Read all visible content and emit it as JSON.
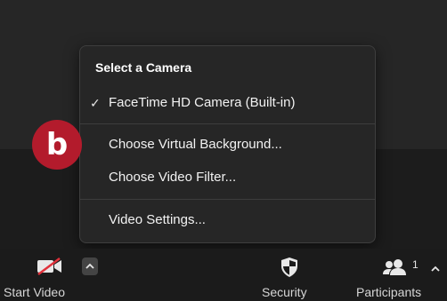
{
  "camera_menu": {
    "header": "Select a Camera",
    "selected_camera": "FaceTime HD Camera (Built-in)",
    "items": [
      "Choose Virtual Background...",
      "Choose Video Filter...",
      "Video Settings..."
    ]
  },
  "badge": {
    "letter": "b",
    "color": "#b31b2c"
  },
  "toolbar": {
    "start_video_label": "Start Video",
    "security_label": "Security",
    "participants_label": "Participants",
    "participants_count": "1"
  }
}
